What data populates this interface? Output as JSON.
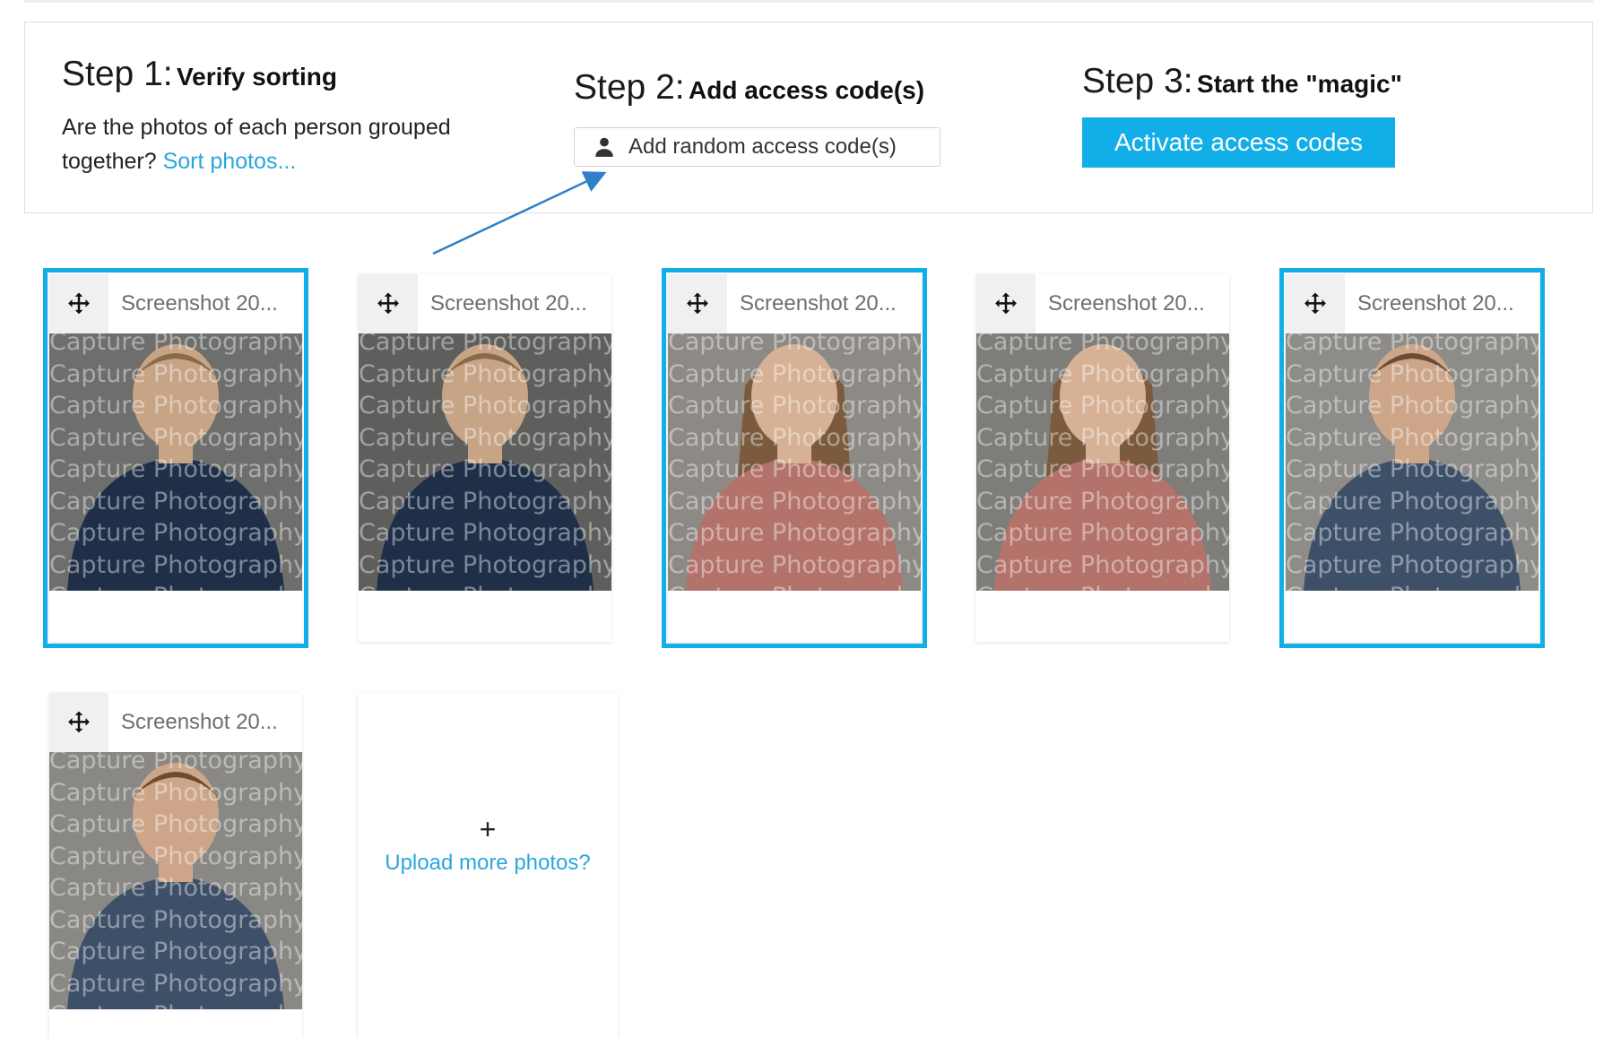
{
  "steps": [
    {
      "num": "Step 1:",
      "title": "Verify sorting",
      "desc": "Are the photos of each person grouped together?",
      "link": "Sort photos..."
    },
    {
      "num": "Step 2:",
      "title": "Add access code(s)",
      "button": "Add random access code(s)"
    },
    {
      "num": "Step 3:",
      "title": "Start the \"magic\"",
      "button": "Activate access codes"
    }
  ],
  "photos": [
    {
      "name": "Screenshot 20...",
      "selected": true,
      "subject": "boy-blue-shirt-1"
    },
    {
      "name": "Screenshot 20...",
      "selected": false,
      "subject": "boy-blue-shirt-2"
    },
    {
      "name": "Screenshot 20...",
      "selected": true,
      "subject": "girl-pink-shirt-1"
    },
    {
      "name": "Screenshot 20...",
      "selected": false,
      "subject": "girl-pink-shirt-2"
    },
    {
      "name": "Screenshot 20...",
      "selected": true,
      "subject": "boy-gray-shirt-1"
    },
    {
      "name": "Screenshot 20...",
      "selected": false,
      "subject": "boy-gray-shirt-2"
    }
  ],
  "watermark": "Capture Photography",
  "upload": {
    "plus": "+",
    "label": "Upload more photos?"
  },
  "colors": {
    "accent": "#12aee8",
    "link": "#2ba6de",
    "arrow": "#2f7fc9"
  }
}
